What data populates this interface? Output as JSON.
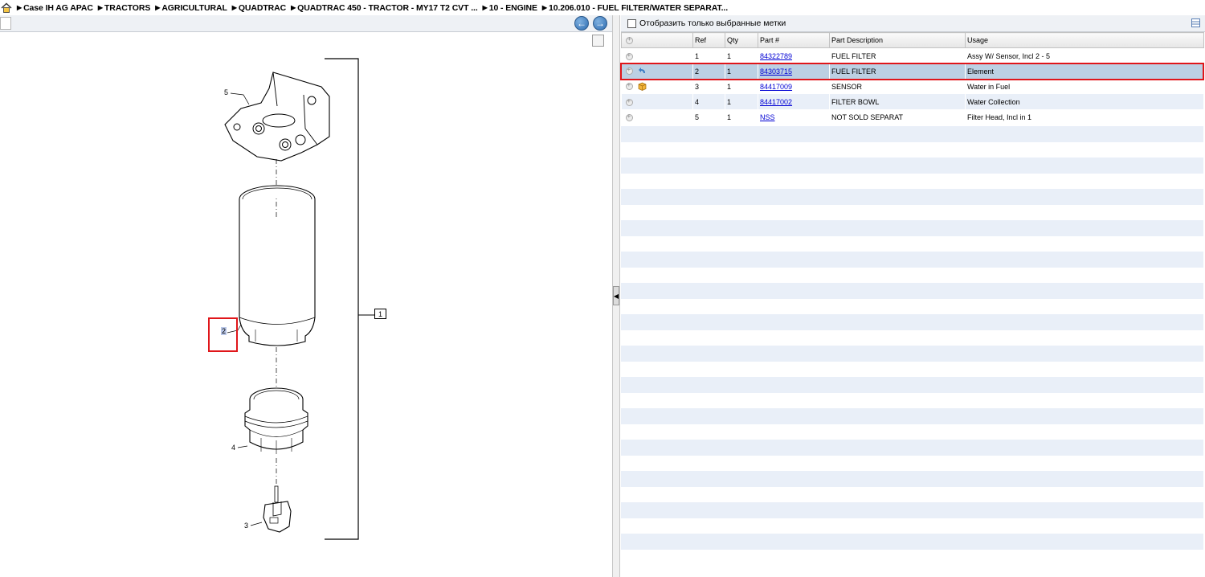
{
  "breadcrumb": [
    "Case IH AG APAC",
    "TRACTORS",
    "AGRICULTURAL",
    "QUADTRAC",
    "QUADTRAC 450 - TRACTOR - MY17 T2 CVT ...",
    "10 - ENGINE",
    "10.206.010 - FUEL FILTER/WATER SEPARAT..."
  ],
  "filter": {
    "label": "Отобразить только выбранные метки"
  },
  "table": {
    "columns": [
      "",
      "Ref",
      "Qty",
      "Part #",
      "Part Description",
      "Usage"
    ],
    "rows": [
      {
        "ref": "1",
        "qty": "1",
        "part": "84322789",
        "desc": "FUEL FILTER",
        "usage": "Assy W/ Sensor, Incl 2 - 5",
        "icon": ""
      },
      {
        "ref": "2",
        "qty": "1",
        "part": "84303715",
        "desc": "FUEL FILTER",
        "usage": "Element",
        "icon": "return-arrow-icon"
      },
      {
        "ref": "3",
        "qty": "1",
        "part": "84417009",
        "desc": "SENSOR",
        "usage": "Water in Fuel",
        "icon": "package-icon"
      },
      {
        "ref": "4",
        "qty": "1",
        "part": "84417002",
        "desc": "FILTER BOWL",
        "usage": "Water Collection",
        "icon": ""
      },
      {
        "ref": "5",
        "qty": "1",
        "part": "NSS",
        "desc": "NOT SOLD SEPARAT",
        "usage": "Filter Head, Incl in 1",
        "icon": ""
      }
    ]
  },
  "diagram": {
    "callouts": {
      "c1": "1",
      "c2": "2",
      "c3": "3",
      "c4": "4",
      "c5": "5"
    }
  },
  "colors": {
    "highlight": "#e0161a",
    "selected_row": "#bcd0e3",
    "alt_row": "#e9eff8",
    "link": "#0000d4"
  }
}
